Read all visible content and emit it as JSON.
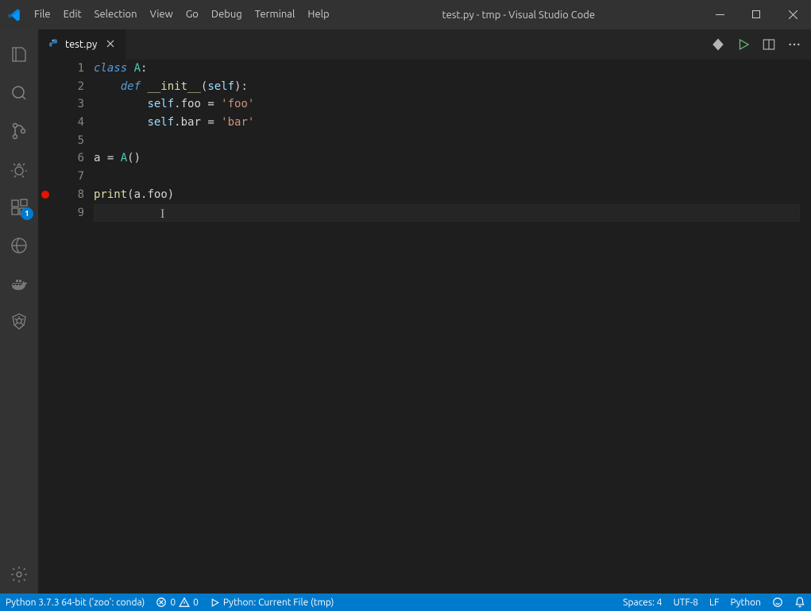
{
  "window": {
    "title": "test.py - tmp - Visual Studio Code"
  },
  "menu": {
    "items": [
      "File",
      "Edit",
      "Selection",
      "View",
      "Go",
      "Debug",
      "Terminal",
      "Help"
    ]
  },
  "activity_bar": {
    "explorer": "explorer",
    "search": "search",
    "scm": "source-control",
    "debug": "debug",
    "extensions_badge": "1"
  },
  "tab": {
    "filename": "test.py"
  },
  "code": {
    "lines": [
      {
        "segments": [
          [
            "kw",
            "class"
          ],
          [
            "pun",
            " "
          ],
          [
            "cls",
            "A"
          ],
          [
            "pun",
            ":"
          ]
        ]
      },
      {
        "indent": 1,
        "segments": [
          [
            "kw",
            "def"
          ],
          [
            "pun",
            " "
          ],
          [
            "fn",
            "__init__"
          ],
          [
            "pun",
            "("
          ],
          [
            "var",
            "self"
          ],
          [
            "pun",
            "):"
          ]
        ]
      },
      {
        "indent": 2,
        "segments": [
          [
            "var",
            "self"
          ],
          [
            "pun",
            "."
          ],
          [
            "pun",
            "foo "
          ],
          [
            "pun",
            "= "
          ],
          [
            "str",
            "'foo'"
          ]
        ]
      },
      {
        "indent": 2,
        "segments": [
          [
            "var",
            "self"
          ],
          [
            "pun",
            "."
          ],
          [
            "pun",
            "bar "
          ],
          [
            "pun",
            "= "
          ],
          [
            "str",
            "'bar'"
          ]
        ]
      },
      {
        "segments": []
      },
      {
        "segments": [
          [
            "pun",
            "a "
          ],
          [
            "pun",
            "= "
          ],
          [
            "cls",
            "A"
          ],
          [
            "pun",
            "()"
          ]
        ]
      },
      {
        "segments": []
      },
      {
        "segments": [
          [
            "fn",
            "print"
          ],
          [
            "pun",
            "("
          ],
          [
            "pun",
            "a"
          ],
          [
            "pun",
            "."
          ],
          [
            "pun",
            "foo"
          ],
          [
            "pun",
            ")"
          ]
        ]
      },
      {
        "segments": []
      }
    ],
    "breakpoint_line": 8,
    "current_line": 9,
    "cursor_col": 10
  },
  "status": {
    "python_env": "Python 3.7.3 64-bit ('zoo': conda)",
    "errors": "0",
    "warnings": "0",
    "debug_config": "Python: Current File (tmp)",
    "indent": "Spaces: 4",
    "encoding": "UTF-8",
    "eol": "LF",
    "language": "Python"
  }
}
